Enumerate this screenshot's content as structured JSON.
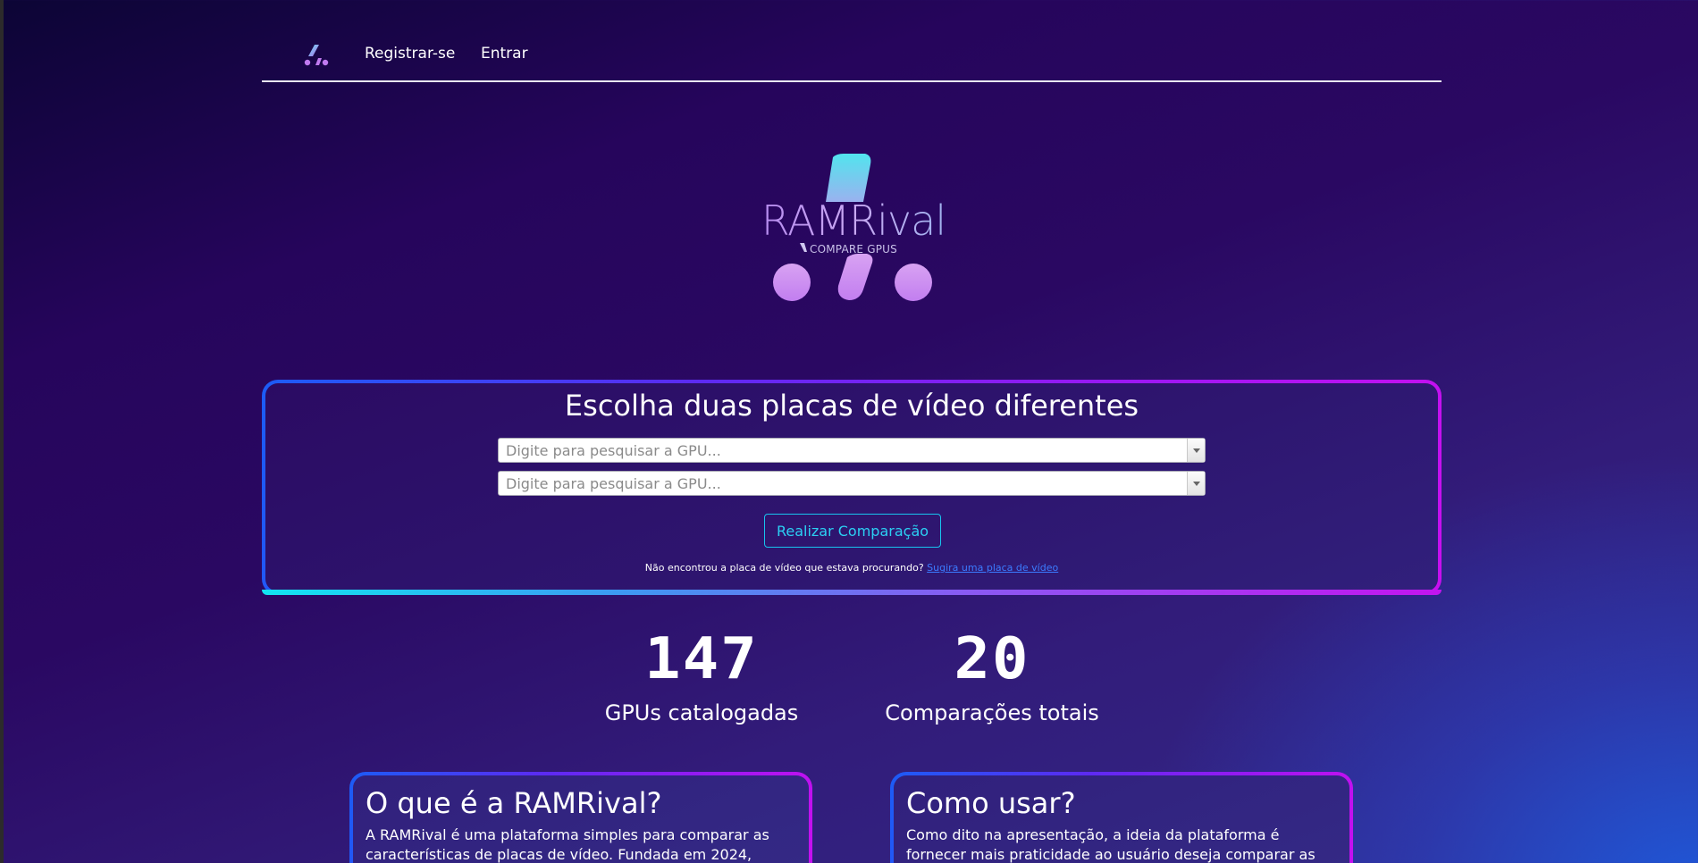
{
  "nav": {
    "logo_icon": "ramrival-mark-icon",
    "register_label": "Registrar-se",
    "login_label": "Entrar"
  },
  "hero": {
    "brand_name": "RAMRival",
    "tagline": "COMPARE GPUS"
  },
  "search": {
    "title": "Escolha duas placas de vídeo diferentes",
    "gpu1_placeholder": "Digite para pesquisar a GPU...",
    "gpu2_placeholder": "Digite para pesquisar a GPU...",
    "compare_button": "Realizar Comparação",
    "hint_text": "Não encontrou a placa de vídeo que estava procurando?",
    "hint_link": "Sugira uma placa de vídeo"
  },
  "stats": {
    "gpus_count": "147",
    "gpus_label": "GPUs catalogadas",
    "comparisons_count": "20",
    "comparisons_label": "Comparações totais"
  },
  "cards": {
    "what_title": "O que é a RAMRival?",
    "what_text": "A RAMRival é uma plataforma simples para comparar as características de placas de vídeo. Fundada em 2024,",
    "how_title": "Como usar?",
    "how_text": "Como dito na apresentação, a ideia da plataforma é fornecer mais praticidade ao usuário deseja comparar as"
  },
  "colors": {
    "accent_cyan": "#2bd0f3",
    "link_blue": "#3b7bff",
    "border_gradient_start": "#1c5cf6",
    "border_gradient_end": "#c80ff0"
  }
}
